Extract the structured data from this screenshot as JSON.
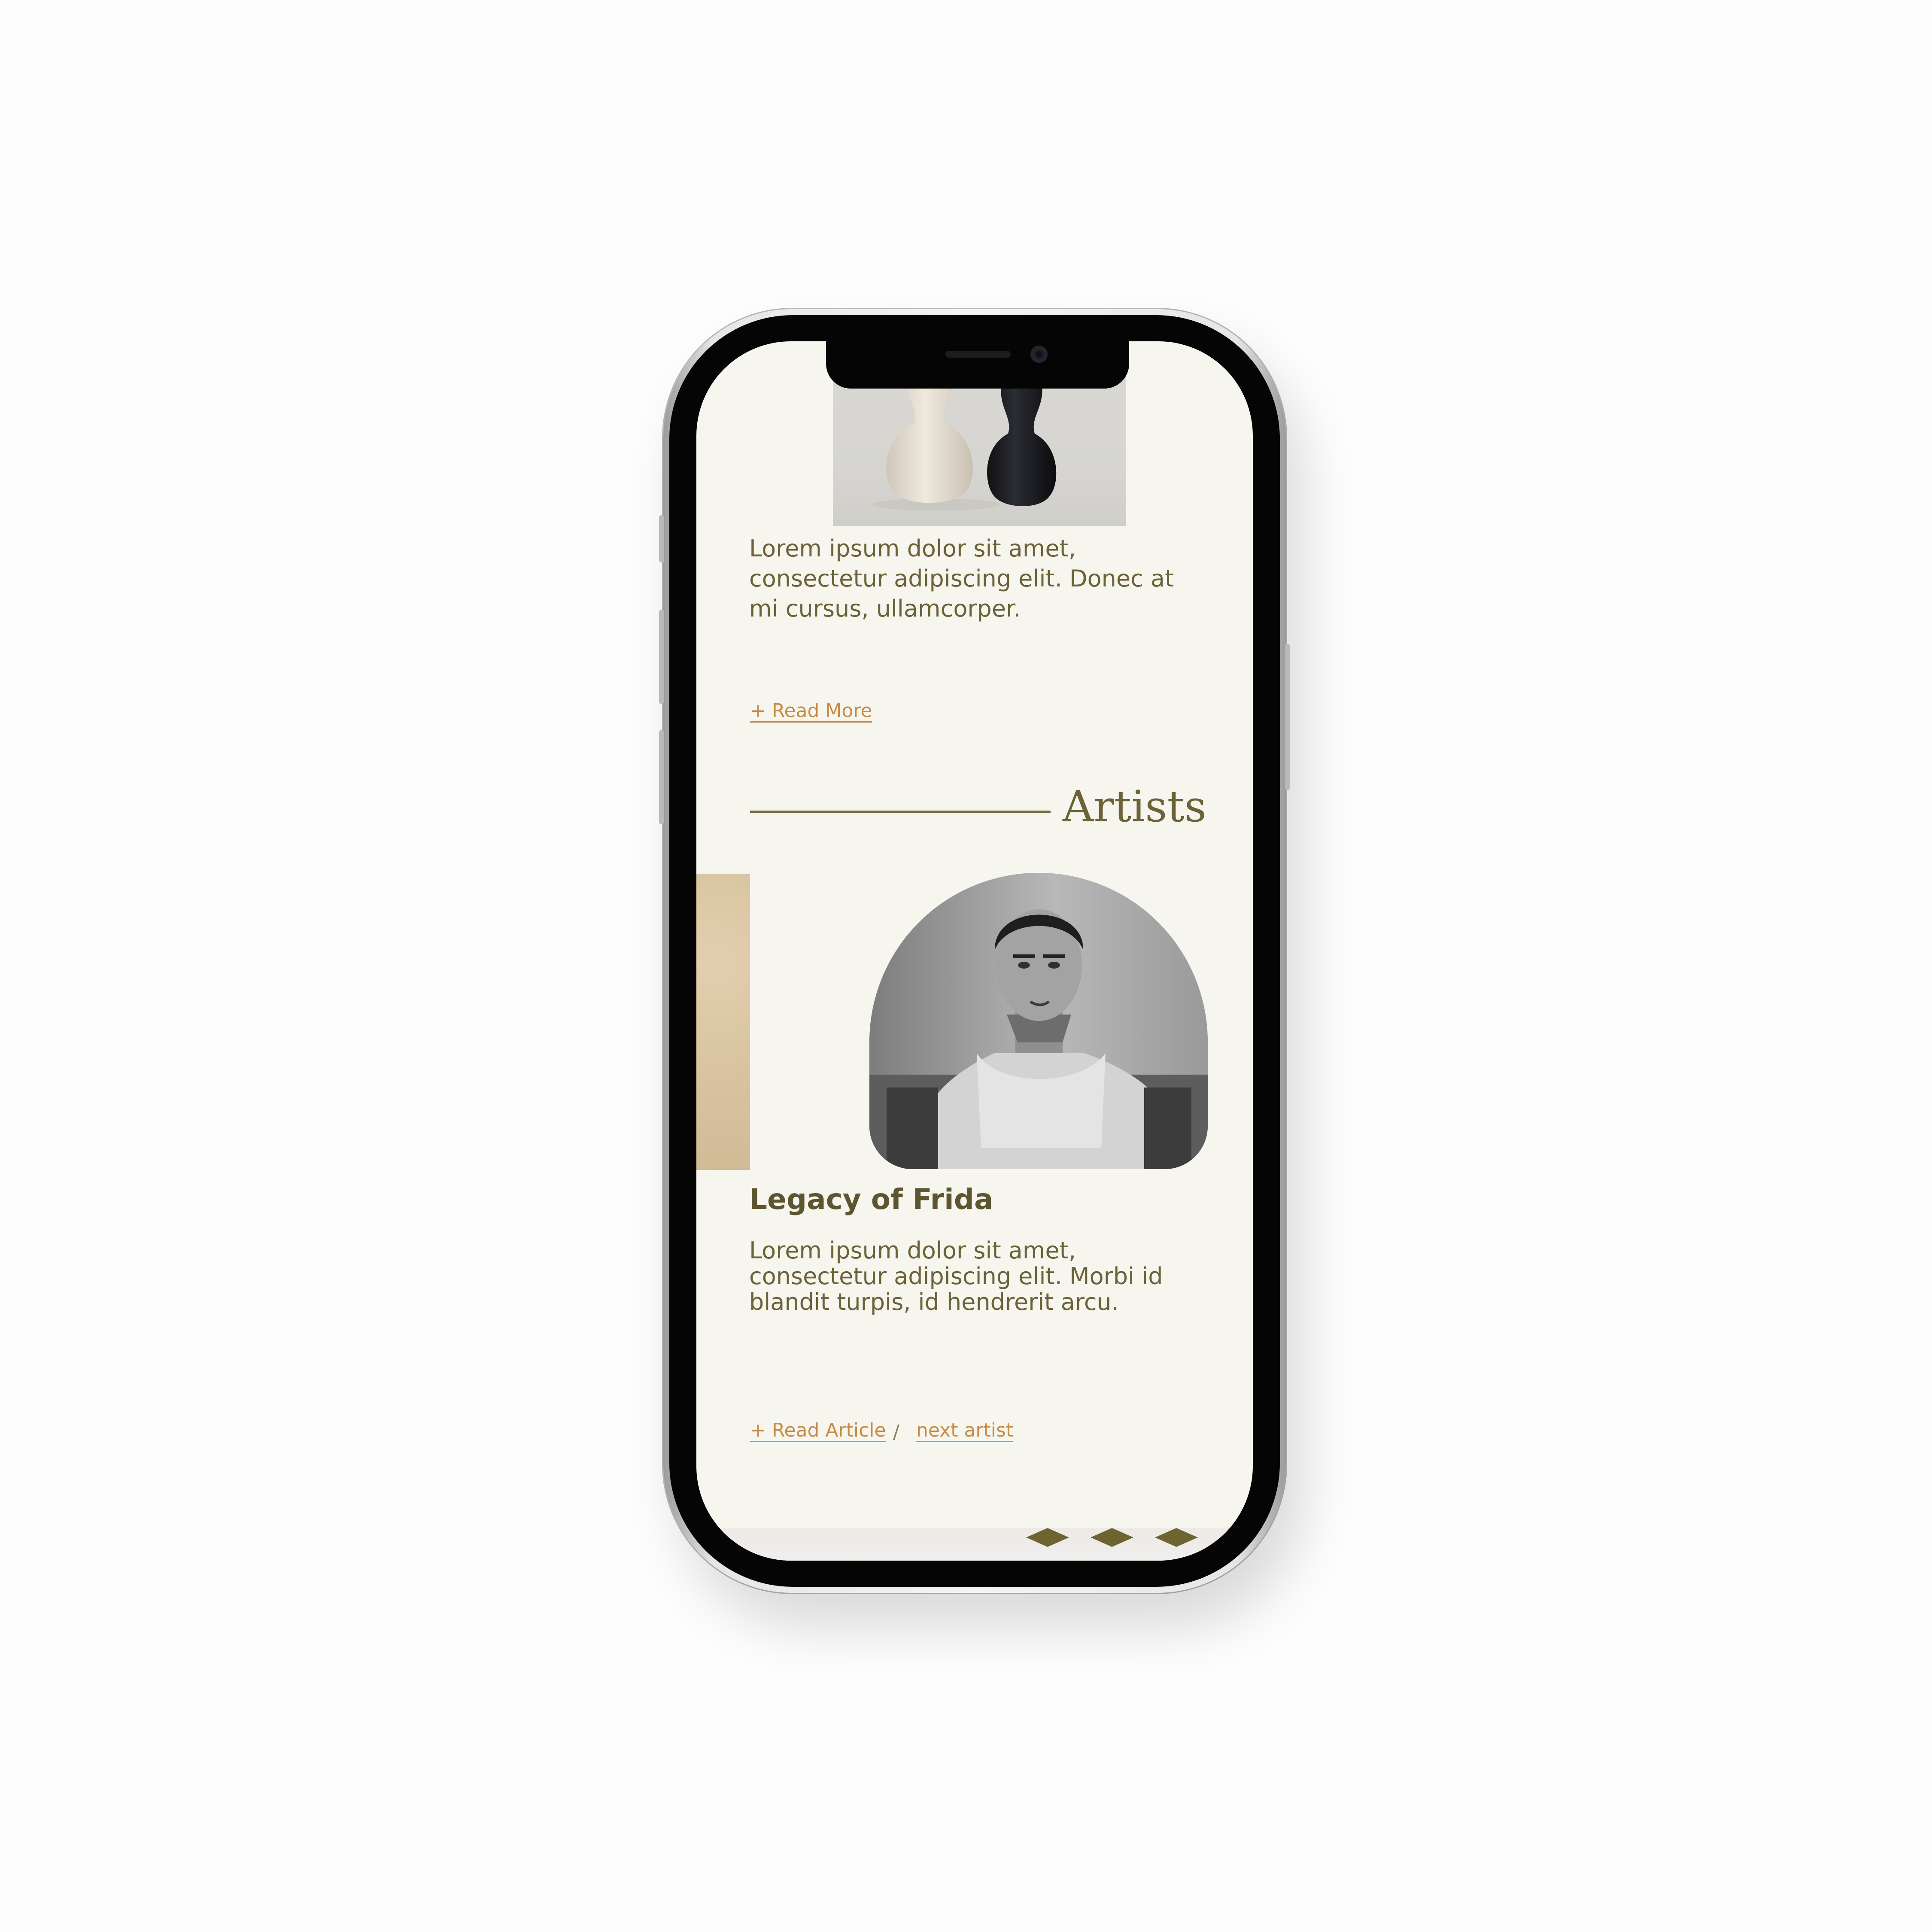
{
  "article_preview": {
    "body": "Lorem ipsum dolor sit amet, consectetur adipiscing elit. Donec at mi cursus, ullamcorper.",
    "read_more": "+ Read More"
  },
  "artists_section": {
    "title": "Artists",
    "artist_name": "Legacy of Frida",
    "body": "Lorem ipsum dolor sit amet, consectetur adipiscing elit. Morbi id blandit turpis, id hendrerit arcu.",
    "read_article": "+ Read Article",
    "separator": "/",
    "next_artist": "next artist"
  },
  "pagination": {
    "count": 3
  },
  "colors": {
    "background": "#f6f6ef",
    "text": "#6b6238",
    "accent": "#c78a45",
    "heading": "#5c5530"
  }
}
